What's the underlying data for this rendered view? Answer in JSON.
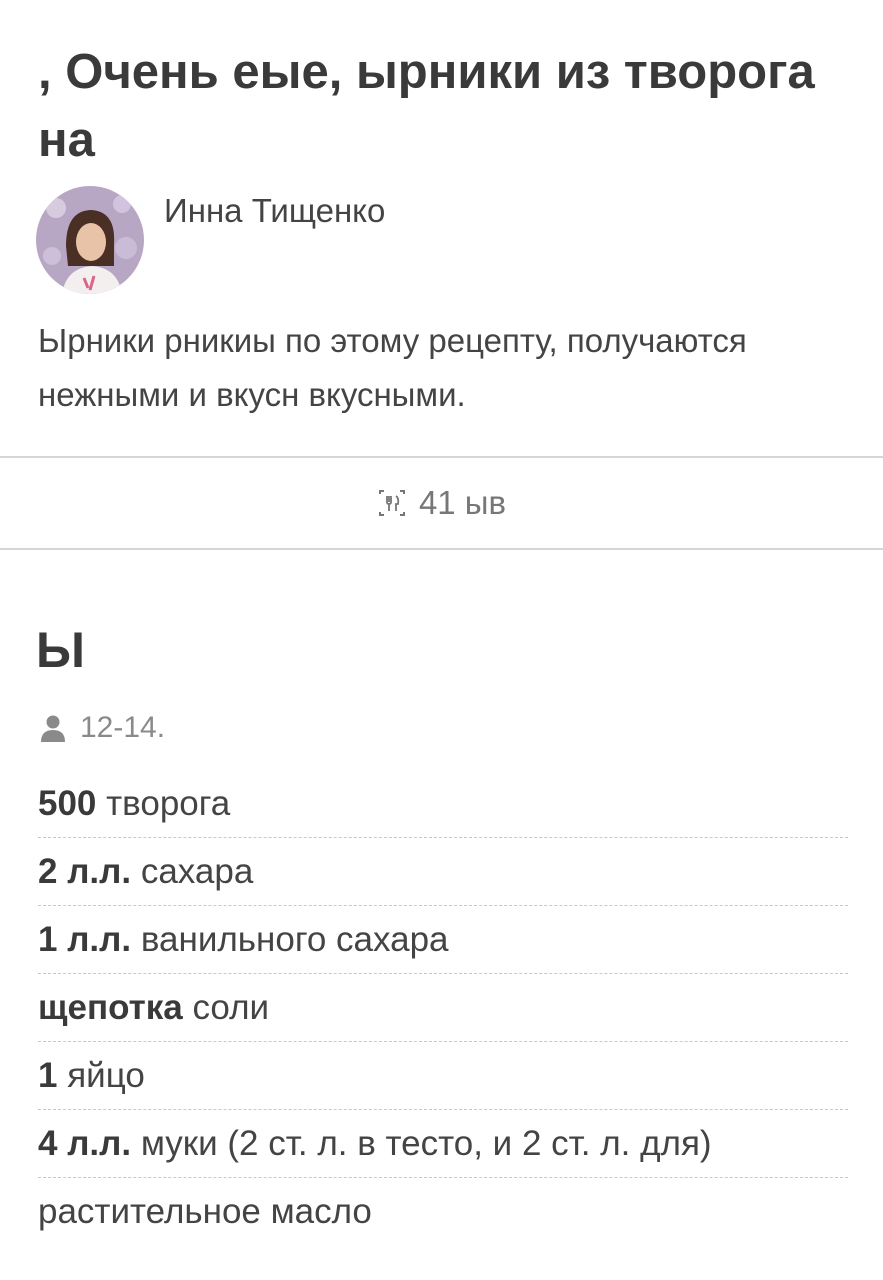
{
  "recipe": {
    "title": ", Очень еые, ырники из творога на",
    "author": {
      "name": "Инна Тищенко",
      "avatar_icon": "author-avatar"
    },
    "description": "Ырники рникиы по этому рецепту, получаются нежными и вкусн вкусными.",
    "stats": {
      "icon": "utensils-icon",
      "text": "41 ыв"
    }
  },
  "ingredients_section": {
    "title": "Ы",
    "servings_icon": "person-icon",
    "servings": "12-14.",
    "items": [
      {
        "qty": "500",
        "name": "творога"
      },
      {
        "qty": "2 л.л.",
        "name": "сахара"
      },
      {
        "qty": "1 л.л.",
        "name": "ванильного сахара"
      },
      {
        "qty": "щепотка",
        "name": "соли"
      },
      {
        "qty": "1",
        "name": "яйцо"
      },
      {
        "qty": "4 л.л.",
        "name": "муки (2 ст. л. в тесто, и 2 ст. л. для)"
      },
      {
        "qty": "",
        "name": "растительное масло"
      }
    ]
  },
  "colors": {
    "text": "#444444",
    "title": "#3a3a3a",
    "muted": "#777777",
    "divider": "#d6d6d6"
  }
}
